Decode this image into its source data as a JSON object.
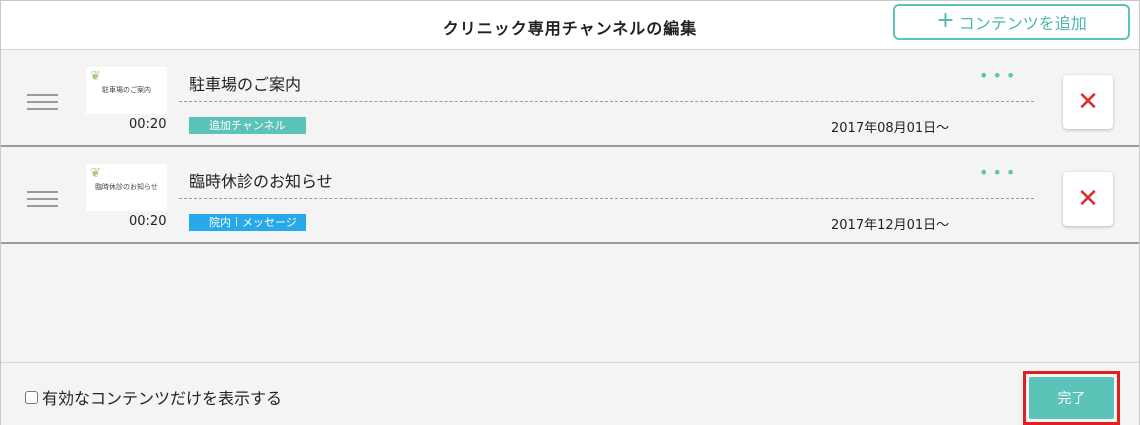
{
  "header": {
    "title": "クリニック専用チャンネルの編集",
    "add_button": {
      "icon": "plus-icon",
      "label": "コンテンツを追加"
    }
  },
  "items": [
    {
      "name": "駐車場のご案内",
      "thumbnail_text": "駐車場のご案内",
      "duration": "00:20",
      "tag": "追加チャンネル",
      "tag_color": "#5cc3b9",
      "date": "2017年08月01日〜",
      "more_icon": "more-dots-icon",
      "delete_icon": "close-icon"
    },
    {
      "name": "臨時休診のお知らせ",
      "thumbnail_text": "臨時休診のお知らせ",
      "duration": "00:20",
      "tag": "院内ｉメッセージ",
      "tag_color": "#27a8e8",
      "date": "2017年12月01日〜",
      "more_icon": "more-dots-icon",
      "delete_icon": "close-icon"
    }
  ],
  "footer": {
    "filter_label": "有効なコンテンツだけを表示する",
    "filter_checked": false,
    "done_label": "完了"
  },
  "colors": {
    "accent": "#5cc3b9",
    "delete": "#d9302c",
    "highlight_outline": "#e0201e"
  }
}
